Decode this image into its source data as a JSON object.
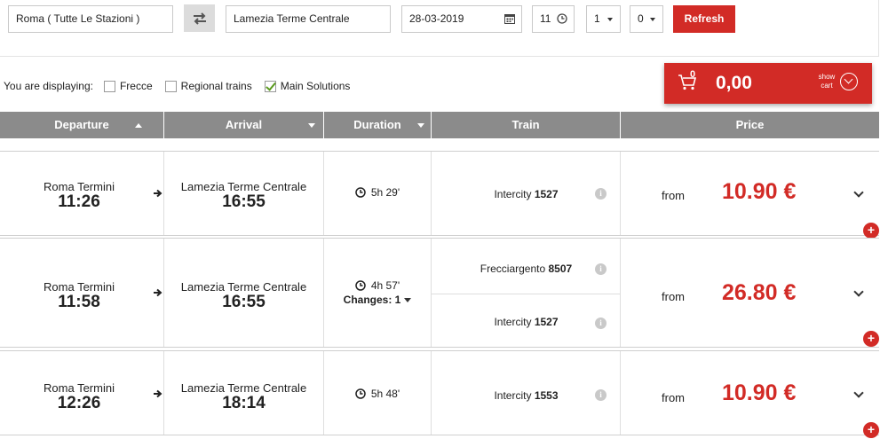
{
  "search": {
    "from": "Roma ( Tutte Le Stazioni )",
    "to": "Lamezia Terme Centrale",
    "date": "28-03-2019",
    "hour": "11",
    "adults": "1",
    "children": "0",
    "refresh_label": "Refresh"
  },
  "filters": {
    "label": "You are displaying:",
    "options": [
      {
        "label": "Frecce",
        "checked": false
      },
      {
        "label": "Regional trains",
        "checked": false
      },
      {
        "label": "Main Solutions",
        "checked": true
      }
    ]
  },
  "cart": {
    "count": "0",
    "amount": "0,00",
    "show_label_1": "show",
    "show_label_2": "cart"
  },
  "table": {
    "headers": [
      "Departure",
      "Arrival",
      "Duration",
      "Train",
      "Price"
    ],
    "rows": [
      {
        "dep_station": "Roma Termini",
        "dep_time": "11:26",
        "arr_station": "Lamezia Terme Centrale",
        "arr_time": "16:55",
        "duration": "5h 29'",
        "changes": "",
        "trains": [
          {
            "name": "Intercity",
            "number": "1527"
          }
        ],
        "from_label": "from",
        "price": "10.90 €"
      },
      {
        "dep_station": "Roma Termini",
        "dep_time": "11:58",
        "arr_station": "Lamezia Terme Centrale",
        "arr_time": "16:55",
        "duration": "4h 57'",
        "changes": "Changes: 1",
        "trains": [
          {
            "name": "Frecciargento",
            "number": "8507"
          },
          {
            "name": "Intercity",
            "number": "1527"
          }
        ],
        "from_label": "from",
        "price": "26.80 €"
      },
      {
        "dep_station": "Roma Termini",
        "dep_time": "12:26",
        "arr_station": "Lamezia Terme Centrale",
        "arr_time": "18:14",
        "duration": "5h 48'",
        "changes": "",
        "trains": [
          {
            "name": "Intercity",
            "number": "1553"
          }
        ],
        "from_label": "from",
        "price": "10.90 €"
      }
    ]
  },
  "colors": {
    "accent": "#d22b26",
    "header_bg": "#8b8b8b"
  }
}
